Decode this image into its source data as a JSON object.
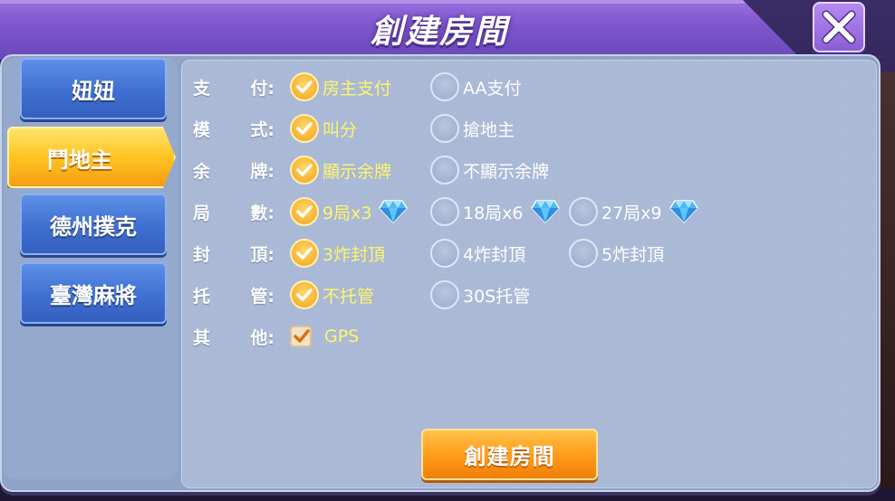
{
  "window": {
    "title": "創建房間"
  },
  "tabs": [
    {
      "label": "妞妞",
      "active": false
    },
    {
      "label": "鬥地主",
      "active": true
    },
    {
      "label": "德州撲克",
      "active": false
    },
    {
      "label": "臺灣麻將",
      "active": false
    }
  ],
  "rows": {
    "payment": {
      "label_a": "支",
      "label_b": "付:",
      "options": [
        {
          "label": "房主支付",
          "selected": true
        },
        {
          "label": "AA支付",
          "selected": false
        }
      ]
    },
    "mode": {
      "label_a": "模",
      "label_b": "式:",
      "options": [
        {
          "label": "叫分",
          "selected": true
        },
        {
          "label": "搶地主",
          "selected": false
        }
      ]
    },
    "remaining": {
      "label_a": "余",
      "label_b": "牌:",
      "options": [
        {
          "label": "顯示余牌",
          "selected": true
        },
        {
          "label": "不顯示余牌",
          "selected": false
        }
      ]
    },
    "rounds": {
      "label_a": "局",
      "label_b": "數:",
      "options": [
        {
          "label": "9局x3",
          "selected": true
        },
        {
          "label": "18局x6",
          "selected": false
        },
        {
          "label": "27局x9",
          "selected": false
        }
      ]
    },
    "cap": {
      "label_a": "封",
      "label_b": "頂:",
      "options": [
        {
          "label": "3炸封頂",
          "selected": true
        },
        {
          "label": "4炸封頂",
          "selected": false
        },
        {
          "label": "5炸封頂",
          "selected": false
        }
      ]
    },
    "auto": {
      "label_a": "托",
      "label_b": "管:",
      "options": [
        {
          "label": "不托管",
          "selected": true
        },
        {
          "label": "30S托管",
          "selected": false
        }
      ]
    },
    "other": {
      "label_a": "其",
      "label_b": "他:",
      "checkbox": {
        "label": "GPS",
        "checked": true
      }
    }
  },
  "actions": {
    "create_label": "創建房間"
  },
  "colors": {
    "accent": "#ff9a1a",
    "selected_text": "#fff56a",
    "tab_blue": "#3f6fd1",
    "tab_active": "#ffc422"
  },
  "icons": {
    "close": "close-x-icon",
    "diamond": "diamond-icon",
    "check": "check-icon"
  }
}
